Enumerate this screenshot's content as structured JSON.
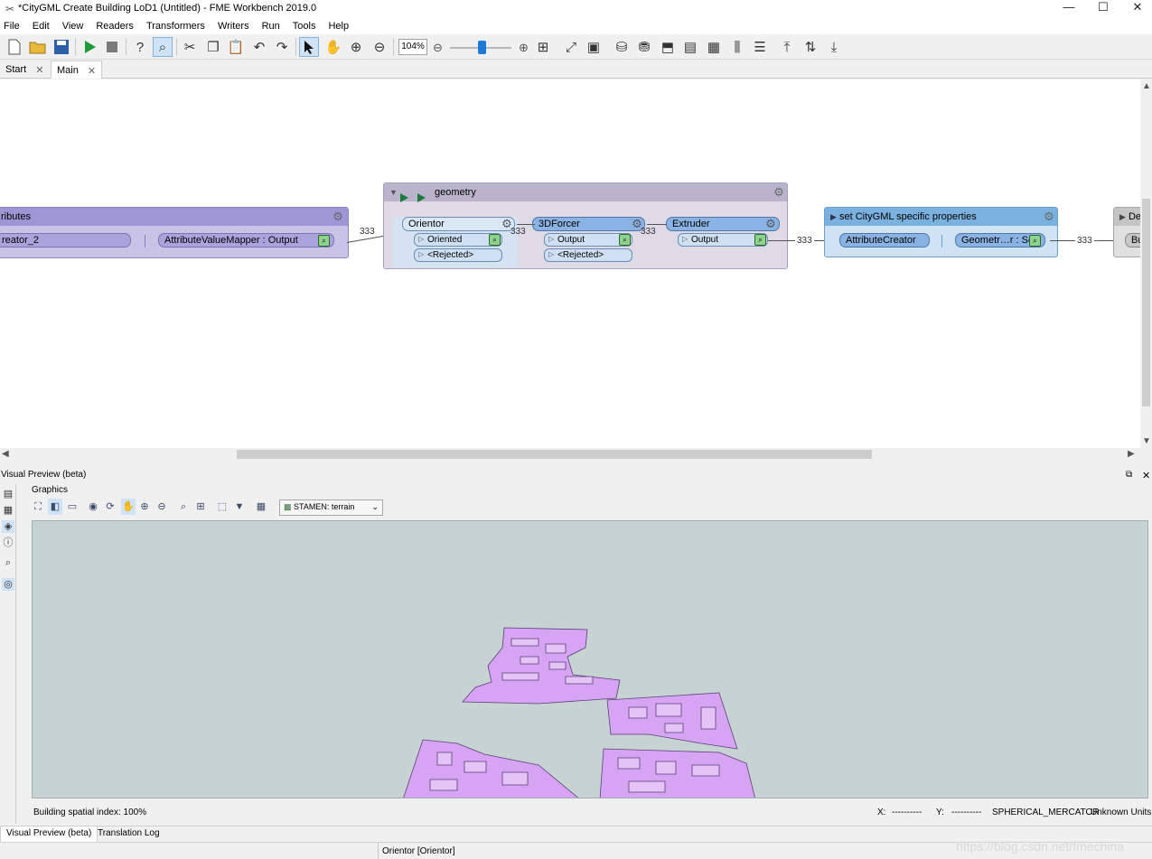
{
  "window": {
    "title": "*CityGML Create Building LoD1 (Untitled) - FME Workbench 2019.0",
    "minimize_glyph": "—",
    "maximize_glyph": "☐",
    "close_glyph": "✕"
  },
  "menu": {
    "file": "File",
    "edit": "Edit",
    "view": "View",
    "readers": "Readers",
    "transformers": "Transformers",
    "writers": "Writers",
    "run": "Run",
    "tools": "Tools",
    "help": "Help"
  },
  "toolbar": {
    "zoom_value": "104%",
    "icons": [
      "new-icon",
      "open-icon",
      "save-icon",
      "run-icon",
      "stop-icon",
      "inspect-help-icon",
      "feature-inspect-icon",
      "cut-icon",
      "copy-icon",
      "paste-icon",
      "undo-icon",
      "redo-icon",
      "select-icon",
      "pan-hand-icon",
      "zoom-in-icon",
      "zoom-out-icon"
    ]
  },
  "tabs": {
    "start": "Start",
    "main": "Main",
    "close_glyph": "✕"
  },
  "canvas": {
    "bookmark_left": {
      "title": "ributes",
      "node_left": "reator_2",
      "node_right": "AttributeValueMapper : Output",
      "count": "333"
    },
    "bookmark_geometry": {
      "title": "geometry",
      "orientor": {
        "name": "Orientor",
        "port_oriented": "Oriented",
        "port_rejected": "<Rejected>",
        "count": "333"
      },
      "forcer": {
        "name": "3DForcer",
        "port_output": "Output",
        "port_rejected": "<Rejected>",
        "count": "333"
      },
      "extruder": {
        "name": "Extruder",
        "port_output": "Output",
        "count": "333"
      }
    },
    "bookmark_citygml": {
      "title": "set CityGML specific properties",
      "node_left": "AttributeCreator",
      "node_right": "Geometr…r : Set",
      "count": "333"
    },
    "bookmark_right": {
      "title": "De",
      "node": "Bu"
    }
  },
  "preview": {
    "title": "Visual Preview (beta)",
    "graphics_label": "Graphics",
    "basemap": "STAMEN: terrain",
    "status": "Building spatial index: 100%",
    "x_label": "X:",
    "x_value": "----------",
    "y_label": "Y:",
    "y_value": "----------",
    "projection": "SPHERICAL_MERCATOR",
    "units": "Unknown Units",
    "bottom_tabs": {
      "visual_preview": "Visual Preview (beta)",
      "translation_log": "Translation Log"
    }
  },
  "footer": {
    "selection": "Orientor [Orientor]",
    "watermark": "https://blog.csdn.net/fmechina"
  },
  "colors": {
    "bookmark_purple": "#9d95d4",
    "bookmark_gray": "#cbc6d7",
    "bookmark_blue": "#7ab1df",
    "node_blue": "#8ab3e3",
    "building_fill": "#d6a4f3",
    "map_bg": "#c6d3d2"
  }
}
